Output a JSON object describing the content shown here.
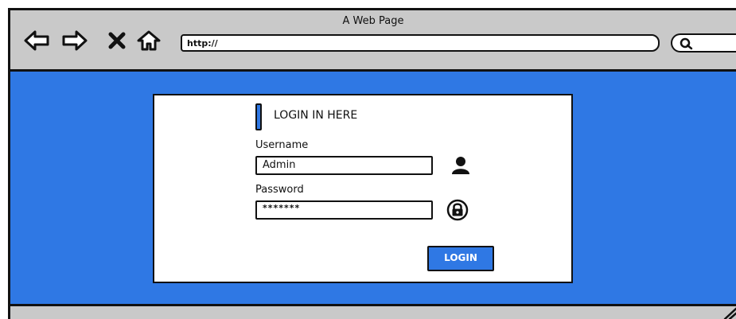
{
  "browser": {
    "title": "A Web Page",
    "url": "http://",
    "nav_icons": [
      "back-arrow-icon",
      "forward-arrow-icon",
      "close-x-icon",
      "home-icon"
    ],
    "search_icon": "search-icon"
  },
  "login": {
    "heading": "LOGIN IN HERE",
    "username_label": "Username",
    "username_value": "Admin",
    "username_icon": "user-icon",
    "password_label": "Password",
    "password_value": "*******",
    "password_icon": "lock-icon",
    "button_label": "LOGIN"
  },
  "colors": {
    "content_background": "#2f78e4",
    "browser_chrome": "#c9c9c9",
    "panel": "#ffffff",
    "outline": "#111111"
  }
}
